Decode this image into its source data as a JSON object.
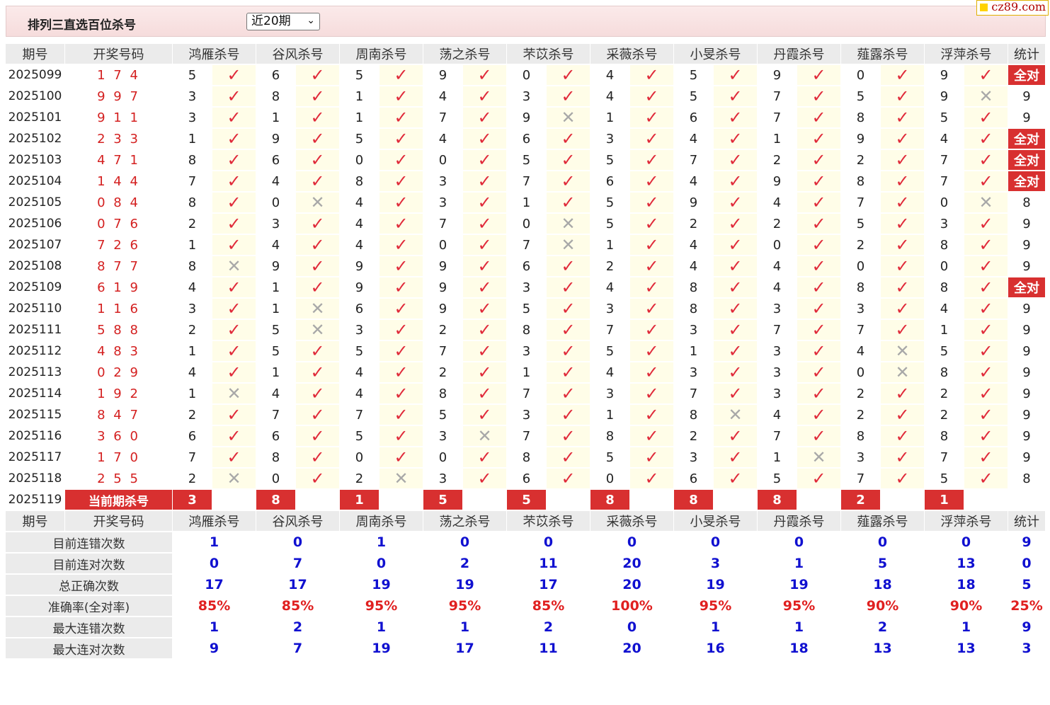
{
  "header": {
    "title": "排列三直选百位杀号",
    "select_value": "近20期",
    "logo": "cz89.com"
  },
  "columns": [
    "期号",
    "开奖号码",
    "鸿雁杀号",
    "谷风杀号",
    "周南杀号",
    "荡之杀号",
    "芣苡杀号",
    "采薇杀号",
    "小旻杀号",
    "丹霞杀号",
    "薤露杀号",
    "浮萍杀号",
    "统计"
  ],
  "rows": [
    {
      "period": "2025099",
      "draw": "1 7 4",
      "kills": [
        [
          5,
          1
        ],
        [
          6,
          1
        ],
        [
          5,
          1
        ],
        [
          9,
          1
        ],
        [
          0,
          1
        ],
        [
          4,
          1
        ],
        [
          5,
          1
        ],
        [
          9,
          1
        ],
        [
          0,
          1
        ],
        [
          9,
          1
        ]
      ],
      "stat": "全对"
    },
    {
      "period": "2025100",
      "draw": "9 9 7",
      "kills": [
        [
          3,
          1
        ],
        [
          8,
          1
        ],
        [
          1,
          1
        ],
        [
          4,
          1
        ],
        [
          3,
          1
        ],
        [
          4,
          1
        ],
        [
          5,
          1
        ],
        [
          7,
          1
        ],
        [
          5,
          1
        ],
        [
          9,
          0
        ]
      ],
      "stat": "9"
    },
    {
      "period": "2025101",
      "draw": "9 1 1",
      "kills": [
        [
          3,
          1
        ],
        [
          1,
          1
        ],
        [
          1,
          1
        ],
        [
          7,
          1
        ],
        [
          9,
          0
        ],
        [
          1,
          1
        ],
        [
          6,
          1
        ],
        [
          7,
          1
        ],
        [
          8,
          1
        ],
        [
          5,
          1
        ]
      ],
      "stat": "9"
    },
    {
      "period": "2025102",
      "draw": "2 3 3",
      "kills": [
        [
          1,
          1
        ],
        [
          9,
          1
        ],
        [
          5,
          1
        ],
        [
          4,
          1
        ],
        [
          6,
          1
        ],
        [
          3,
          1
        ],
        [
          4,
          1
        ],
        [
          1,
          1
        ],
        [
          9,
          1
        ],
        [
          4,
          1
        ]
      ],
      "stat": "全对"
    },
    {
      "period": "2025103",
      "draw": "4 7 1",
      "kills": [
        [
          8,
          1
        ],
        [
          6,
          1
        ],
        [
          0,
          1
        ],
        [
          0,
          1
        ],
        [
          5,
          1
        ],
        [
          5,
          1
        ],
        [
          7,
          1
        ],
        [
          2,
          1
        ],
        [
          2,
          1
        ],
        [
          7,
          1
        ]
      ],
      "stat": "全对"
    },
    {
      "period": "2025104",
      "draw": "1 4 4",
      "kills": [
        [
          7,
          1
        ],
        [
          4,
          1
        ],
        [
          8,
          1
        ],
        [
          3,
          1
        ],
        [
          7,
          1
        ],
        [
          6,
          1
        ],
        [
          4,
          1
        ],
        [
          9,
          1
        ],
        [
          8,
          1
        ],
        [
          7,
          1
        ]
      ],
      "stat": "全对"
    },
    {
      "period": "2025105",
      "draw": "0 8 4",
      "kills": [
        [
          8,
          1
        ],
        [
          0,
          0
        ],
        [
          4,
          1
        ],
        [
          3,
          1
        ],
        [
          1,
          1
        ],
        [
          5,
          1
        ],
        [
          9,
          1
        ],
        [
          4,
          1
        ],
        [
          7,
          1
        ],
        [
          0,
          0
        ]
      ],
      "stat": "8"
    },
    {
      "period": "2025106",
      "draw": "0 7 6",
      "kills": [
        [
          2,
          1
        ],
        [
          3,
          1
        ],
        [
          4,
          1
        ],
        [
          7,
          1
        ],
        [
          0,
          0
        ],
        [
          5,
          1
        ],
        [
          2,
          1
        ],
        [
          2,
          1
        ],
        [
          5,
          1
        ],
        [
          3,
          1
        ]
      ],
      "stat": "9"
    },
    {
      "period": "2025107",
      "draw": "7 2 6",
      "kills": [
        [
          1,
          1
        ],
        [
          4,
          1
        ],
        [
          4,
          1
        ],
        [
          0,
          1
        ],
        [
          7,
          0
        ],
        [
          1,
          1
        ],
        [
          4,
          1
        ],
        [
          0,
          1
        ],
        [
          2,
          1
        ],
        [
          8,
          1
        ]
      ],
      "stat": "9"
    },
    {
      "period": "2025108",
      "draw": "8 7 7",
      "kills": [
        [
          8,
          0
        ],
        [
          9,
          1
        ],
        [
          9,
          1
        ],
        [
          9,
          1
        ],
        [
          6,
          1
        ],
        [
          2,
          1
        ],
        [
          4,
          1
        ],
        [
          4,
          1
        ],
        [
          0,
          1
        ],
        [
          0,
          1
        ]
      ],
      "stat": "9"
    },
    {
      "period": "2025109",
      "draw": "6 1 9",
      "kills": [
        [
          4,
          1
        ],
        [
          1,
          1
        ],
        [
          9,
          1
        ],
        [
          9,
          1
        ],
        [
          3,
          1
        ],
        [
          4,
          1
        ],
        [
          8,
          1
        ],
        [
          4,
          1
        ],
        [
          8,
          1
        ],
        [
          8,
          1
        ]
      ],
      "stat": "全对"
    },
    {
      "period": "2025110",
      "draw": "1 1 6",
      "kills": [
        [
          3,
          1
        ],
        [
          1,
          0
        ],
        [
          6,
          1
        ],
        [
          9,
          1
        ],
        [
          5,
          1
        ],
        [
          3,
          1
        ],
        [
          8,
          1
        ],
        [
          3,
          1
        ],
        [
          3,
          1
        ],
        [
          4,
          1
        ]
      ],
      "stat": "9"
    },
    {
      "period": "2025111",
      "draw": "5 8 8",
      "kills": [
        [
          2,
          1
        ],
        [
          5,
          0
        ],
        [
          3,
          1
        ],
        [
          2,
          1
        ],
        [
          8,
          1
        ],
        [
          7,
          1
        ],
        [
          3,
          1
        ],
        [
          7,
          1
        ],
        [
          7,
          1
        ],
        [
          1,
          1
        ]
      ],
      "stat": "9"
    },
    {
      "period": "2025112",
      "draw": "4 8 3",
      "kills": [
        [
          1,
          1
        ],
        [
          5,
          1
        ],
        [
          5,
          1
        ],
        [
          7,
          1
        ],
        [
          3,
          1
        ],
        [
          5,
          1
        ],
        [
          1,
          1
        ],
        [
          3,
          1
        ],
        [
          4,
          0
        ],
        [
          5,
          1
        ]
      ],
      "stat": "9"
    },
    {
      "period": "2025113",
      "draw": "0 2 9",
      "kills": [
        [
          4,
          1
        ],
        [
          1,
          1
        ],
        [
          4,
          1
        ],
        [
          2,
          1
        ],
        [
          1,
          1
        ],
        [
          4,
          1
        ],
        [
          3,
          1
        ],
        [
          3,
          1
        ],
        [
          0,
          0
        ],
        [
          8,
          1
        ]
      ],
      "stat": "9"
    },
    {
      "period": "2025114",
      "draw": "1 9 2",
      "kills": [
        [
          1,
          0
        ],
        [
          4,
          1
        ],
        [
          4,
          1
        ],
        [
          8,
          1
        ],
        [
          7,
          1
        ],
        [
          3,
          1
        ],
        [
          7,
          1
        ],
        [
          3,
          1
        ],
        [
          2,
          1
        ],
        [
          2,
          1
        ]
      ],
      "stat": "9"
    },
    {
      "period": "2025115",
      "draw": "8 4 7",
      "kills": [
        [
          2,
          1
        ],
        [
          7,
          1
        ],
        [
          7,
          1
        ],
        [
          5,
          1
        ],
        [
          3,
          1
        ],
        [
          1,
          1
        ],
        [
          8,
          0
        ],
        [
          4,
          1
        ],
        [
          2,
          1
        ],
        [
          2,
          1
        ]
      ],
      "stat": "9"
    },
    {
      "period": "2025116",
      "draw": "3 6 0",
      "kills": [
        [
          6,
          1
        ],
        [
          6,
          1
        ],
        [
          5,
          1
        ],
        [
          3,
          0
        ],
        [
          7,
          1
        ],
        [
          8,
          1
        ],
        [
          2,
          1
        ],
        [
          7,
          1
        ],
        [
          8,
          1
        ],
        [
          8,
          1
        ]
      ],
      "stat": "9"
    },
    {
      "period": "2025117",
      "draw": "1 7 0",
      "kills": [
        [
          7,
          1
        ],
        [
          8,
          1
        ],
        [
          0,
          1
        ],
        [
          0,
          1
        ],
        [
          8,
          1
        ],
        [
          5,
          1
        ],
        [
          3,
          1
        ],
        [
          1,
          0
        ],
        [
          3,
          1
        ],
        [
          7,
          1
        ]
      ],
      "stat": "9"
    },
    {
      "period": "2025118",
      "draw": "2 5 5",
      "kills": [
        [
          2,
          0
        ],
        [
          0,
          1
        ],
        [
          2,
          0
        ],
        [
          3,
          1
        ],
        [
          6,
          1
        ],
        [
          0,
          1
        ],
        [
          6,
          1
        ],
        [
          5,
          1
        ],
        [
          7,
          1
        ],
        [
          5,
          1
        ]
      ],
      "stat": "8"
    }
  ],
  "current": {
    "period": "2025119",
    "label": "当前期杀号",
    "kills": [
      "3",
      "8",
      "1",
      "5",
      "5",
      "8",
      "8",
      "8",
      "2",
      "1"
    ]
  },
  "summary": [
    {
      "label": "目前连错次数",
      "values": [
        "1",
        "0",
        "1",
        "0",
        "0",
        "0",
        "0",
        "0",
        "0",
        "0",
        "9"
      ],
      "pct": false
    },
    {
      "label": "目前连对次数",
      "values": [
        "0",
        "7",
        "0",
        "2",
        "11",
        "20",
        "3",
        "1",
        "5",
        "13",
        "0"
      ],
      "pct": false
    },
    {
      "label": "总正确次数",
      "values": [
        "17",
        "17",
        "19",
        "19",
        "17",
        "20",
        "19",
        "19",
        "18",
        "18",
        "5"
      ],
      "pct": false
    },
    {
      "label": "准确率(全对率)",
      "values": [
        "85%",
        "85%",
        "95%",
        "95%",
        "85%",
        "100%",
        "95%",
        "95%",
        "90%",
        "90%",
        "25%"
      ],
      "pct": true
    },
    {
      "label": "最大连错次数",
      "values": [
        "1",
        "2",
        "1",
        "1",
        "2",
        "0",
        "1",
        "1",
        "2",
        "1",
        "9"
      ],
      "pct": false
    },
    {
      "label": "最大连对次数",
      "values": [
        "9",
        "7",
        "19",
        "17",
        "11",
        "20",
        "16",
        "18",
        "13",
        "13",
        "3"
      ],
      "pct": false
    }
  ],
  "icons": {
    "correct": "check-icon",
    "wrong": "cross-icon"
  }
}
